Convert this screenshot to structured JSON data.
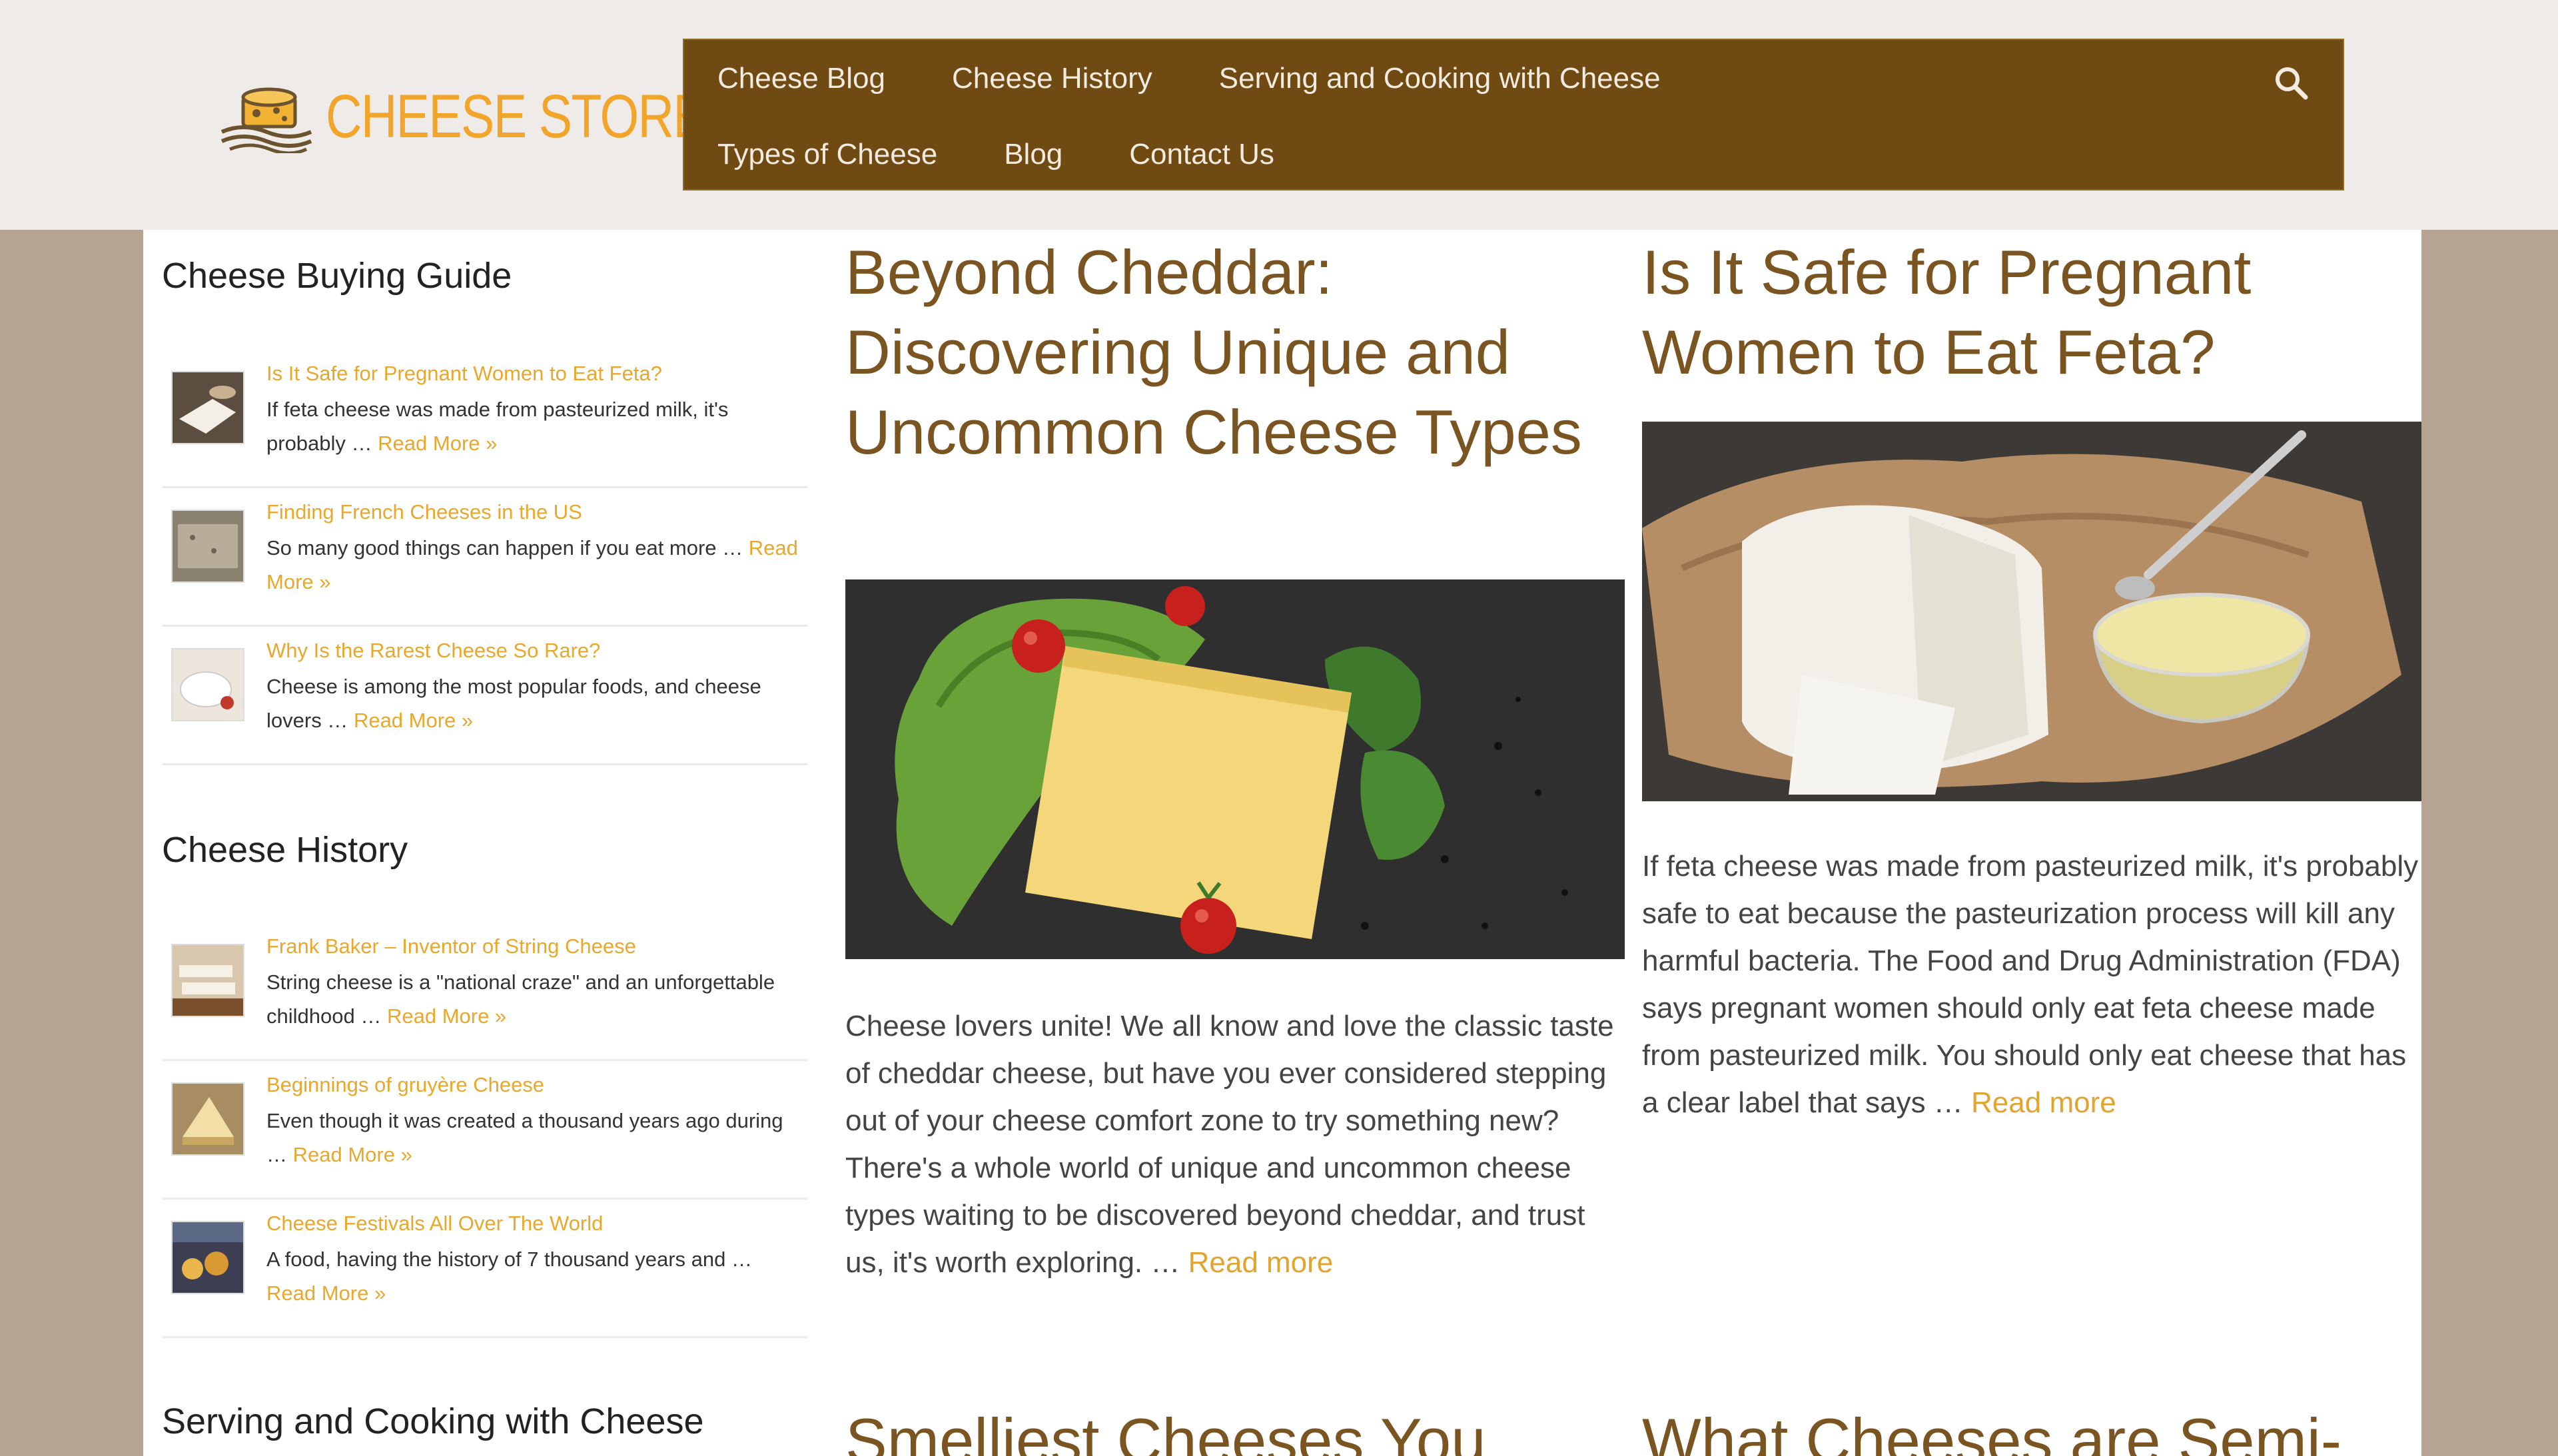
{
  "logo": {
    "text": "CHEESE STORE"
  },
  "nav": {
    "row1": [
      "Cheese Blog",
      "Cheese History",
      "Serving and Cooking with Cheese"
    ],
    "row2": [
      "Types of Cheese",
      "Blog",
      "Contact Us"
    ]
  },
  "sidebar": {
    "widgets": [
      {
        "title": "Cheese Buying Guide",
        "items": [
          {
            "title": "Is It Safe for Pregnant Women to Eat Feta?",
            "excerpt": "If feta cheese was made from pasteurized milk, it's probably …",
            "more": "Read More »"
          },
          {
            "title": "Finding French Cheeses in the US",
            "excerpt": "So many good things can happen if you eat more …",
            "more": "Read More »"
          },
          {
            "title": "Why Is the Rarest Cheese So Rare?",
            "excerpt": "Cheese is among the most popular foods, and cheese lovers …",
            "more": "Read More »"
          }
        ]
      },
      {
        "title": "Cheese History",
        "items": [
          {
            "title": "Frank Baker – Inventor of String Cheese",
            "excerpt": "String cheese is a \"national craze\" and an unforgettable childhood …",
            "more": "Read More »"
          },
          {
            "title": "Beginnings of gruyère Cheese",
            "excerpt": "Even though it was created a thousand years ago during …",
            "more": "Read More »"
          },
          {
            "title": "Cheese Festivals All Over The World",
            "excerpt": "A food, having the history of 7 thousand years and …",
            "more": "Read More »"
          }
        ]
      },
      {
        "title": "Serving and Cooking with Cheese",
        "items": []
      }
    ]
  },
  "posts": [
    {
      "title": "Beyond Cheddar: Discovering Unique and Uncommon Cheese Types",
      "excerpt": "Cheese lovers unite! We all know and love the classic taste of cheddar cheese, but have you ever considered stepping out of your cheese comfort zone to try something new? There's a whole world of unique and uncommon cheese types waiting to be discovered beyond cheddar, and trust us, it's worth exploring. …",
      "more": "Read more"
    },
    {
      "title": "Is It Safe for Pregnant Women to Eat Feta?",
      "excerpt": "If feta cheese was made from pasteurized milk, it's probably safe to eat because the pasteurization process will kill any harmful bacteria. The Food and Drug Administration (FDA) says pregnant women should only eat feta cheese made from pasteurized milk. You should only eat cheese that has a clear label that says …",
      "more": "Read more"
    },
    {
      "title": "Smelliest Cheeses You"
    },
    {
      "title": "What Cheeses are Semi-"
    }
  ],
  "colors": {
    "nav_bg": "#6f4a12",
    "accent": "#e9a72b",
    "title": "#7a5521",
    "page_bg": "#b7a492"
  },
  "icons": {
    "search": "search-icon"
  }
}
